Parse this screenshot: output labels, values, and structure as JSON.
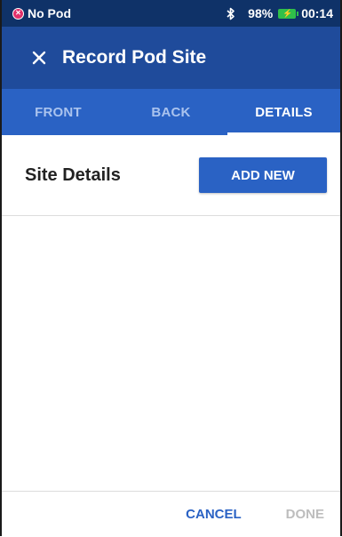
{
  "status_bar": {
    "pod_status": "No Pod",
    "pod_icon": "pod-error-icon",
    "bluetooth_icon": "bluetooth-icon",
    "battery_percent": "98%",
    "battery_icon": "battery-charging-icon",
    "time": "00:14"
  },
  "header": {
    "close_icon": "close-icon",
    "title": "Record Pod Site"
  },
  "tabs": [
    {
      "label": "FRONT",
      "active": false
    },
    {
      "label": "BACK",
      "active": false
    },
    {
      "label": "DETAILS",
      "active": true
    }
  ],
  "section": {
    "title": "Site Details",
    "add_button": "ADD NEW"
  },
  "footer": {
    "cancel_label": "CANCEL",
    "done_label": "DONE"
  },
  "colors": {
    "status_bar_bg": "#0f3268",
    "title_bar_bg": "#1f4b9b",
    "tab_bar_bg": "#2a62c4",
    "accent": "#2a62c4",
    "disabled": "#bdbdbd"
  }
}
